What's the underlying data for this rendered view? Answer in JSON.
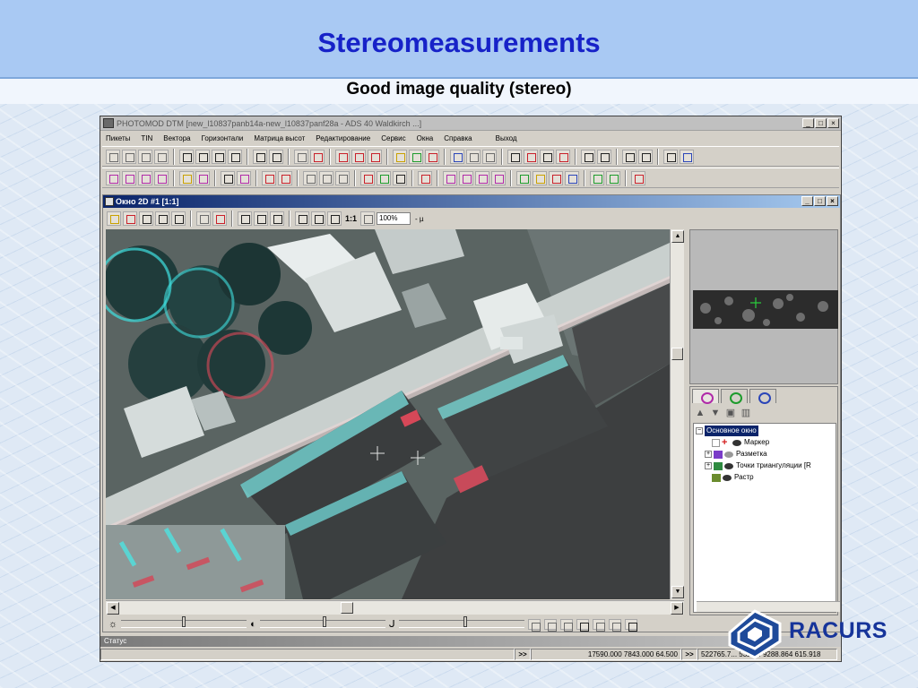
{
  "slide": {
    "title": "Stereomeasurements",
    "subtitle": "Good image quality (stereo)"
  },
  "window": {
    "title": "PHOTOMOD DTM [new_l10837panb14a-new_l10837panf28a - ADS 40 Waldkirch ...]",
    "buttons": [
      "_",
      "□",
      "×"
    ]
  },
  "menu": [
    "Пикеты",
    "TIN",
    "Вектора",
    "Горизонтали",
    "Матрица высот",
    "Редактирование",
    "Сервис",
    "Окна",
    "Справка",
    "Выход"
  ],
  "toolbar": {
    "row1_icons": [
      "pickets-icon",
      "pickets-line-icon",
      "pickets-area-icon",
      "pickets-triangle-icon",
      "copy-icon",
      "copy2-icon",
      "copy3-icon",
      "copy4-icon",
      "rect-icon",
      "polygon-icon",
      "layer-icon",
      "cross-box-icon",
      "mark-100-icon",
      "mark-100b-icon",
      "mark-line-icon",
      "tin-icon",
      "triangle-icon",
      "diag-line-icon",
      "undo-icon",
      "save-icon",
      "redo-icon",
      "grid-icon",
      "book-icon",
      "window-icon",
      "curve-icon",
      "arrows-icon",
      "swap-icon",
      "rotate-icon",
      "split-icon",
      "node-icon",
      "refresh-icon"
    ],
    "row2_icons": [
      "vector-v-icon",
      "vector-v2-icon",
      "vector-path-icon",
      "vector-m-icon",
      "vector-t-icon",
      "vector-t2-icon",
      "vector-s-icon",
      "vector-w-icon",
      "vector-box-icon",
      "vector-box2-icon",
      "vector-a-icon",
      "vector-b-icon",
      "vector-c-icon",
      "vector-d-icon",
      "vector-e-icon",
      "vector-f-icon",
      "3d-icon",
      "2d-icon",
      "3d-b-icon",
      "2d-b-icon",
      "filter-icon",
      "star-icon",
      "plus-icon",
      "lz-icon",
      "tri2-icon",
      "tri3-icon",
      "layers-delete-icon"
    ],
    "row2_labels": [
      "3D",
      "2D",
      "3D",
      "2D"
    ]
  },
  "inner_window": {
    "title": "Окно 2D #1 [1:1]",
    "zoom_label": "1:1",
    "zoom_value": "100%",
    "suffix": "- µ"
  },
  "layers": {
    "root": "Основное окно",
    "items": [
      {
        "label": "Маркер",
        "icon": "marker-icon"
      },
      {
        "label": "Разметка",
        "icon": "markup-icon"
      },
      {
        "label": "Точки триангуляции [R",
        "icon": "triangulation-points-icon"
      },
      {
        "label": "Растр",
        "icon": "raster-icon"
      }
    ]
  },
  "status": {
    "label": "Статус",
    "coords1": "17590.000 7843.000 64.500",
    "coords2": "522765.7... 5328... 9288.864 615.918"
  },
  "logo": {
    "text": "RACURS"
  }
}
